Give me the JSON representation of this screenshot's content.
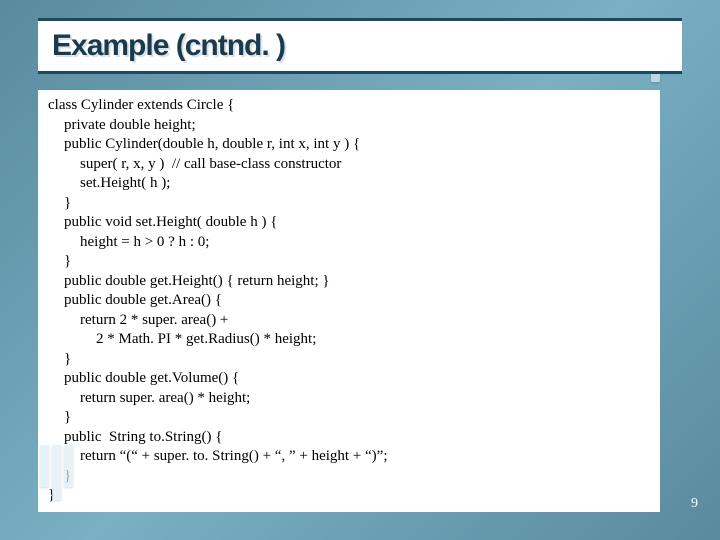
{
  "title": "Example (cntnd. )",
  "page_number": "9",
  "code": {
    "l0": "class Cylinder extends Circle {",
    "l1": "private double height;",
    "l2": "public Cylinder(double h, double r, int x, int y ) {",
    "l3": "super( r, x, y )  // call base-class constructor",
    "l4": "set.Height( h );",
    "l5": "}",
    "l6": "public void set.Height( double h ) {",
    "l7": "height = h > 0 ? h : 0;",
    "l8": "}",
    "l9": "public double get.Height() { return height; }",
    "l10": "public double get.Area() {",
    "l11": "return 2 * super. area() +",
    "l12": "2 * Math. PI * get.Radius() * height;",
    "l13": "}",
    "l14": "public double get.Volume() {",
    "l15": "return super. area() * height;",
    "l16": "}",
    "l17": "public  String to.String() {",
    "l18": "return “(“ + super. to. String() + “, ” + height + “)”;",
    "l19": "}",
    "l20": "}"
  }
}
